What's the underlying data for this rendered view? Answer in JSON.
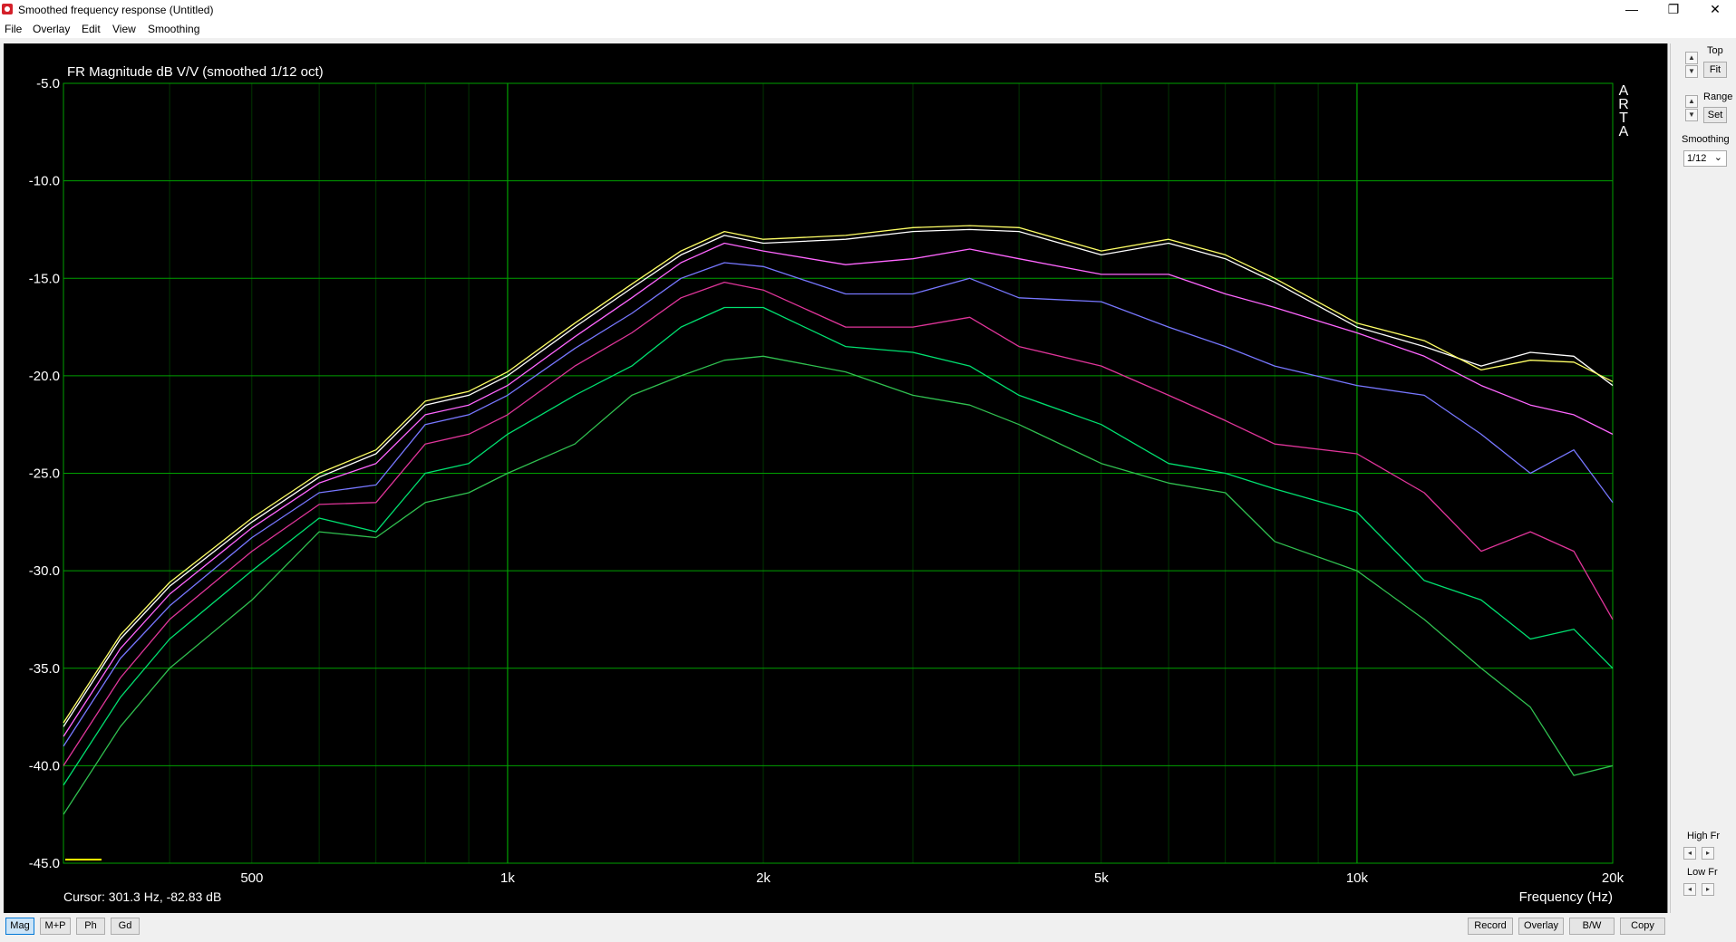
{
  "window": {
    "title": "Smoothed frequency response (Untitled)",
    "minimize_glyph": "—",
    "restore_glyph": "❐",
    "close_glyph": "✕"
  },
  "menu": [
    "File",
    "Overlay",
    "Edit",
    "View",
    "Smoothing"
  ],
  "plot": {
    "title": "FR Magnitude dB V/V (smoothed 1/12 oct)",
    "arta_letters": [
      "A",
      "R",
      "T",
      "A"
    ],
    "cursor_readout": "Cursor: 301.3 Hz, -82.83 dB",
    "background_color": "#000000",
    "grid_color": "#00a000"
  },
  "right_panel": {
    "top_label": "Top",
    "fit_label": "Fit",
    "range_label": "Range",
    "set_label": "Set",
    "smoothing_label": "Smoothing",
    "smoothing_value": "1/12",
    "high_fr_label": "High Fr",
    "low_fr_label": "Low Fr",
    "spin_up": "▲",
    "spin_down": "▼",
    "spin_left": "◂",
    "spin_right": "▸",
    "dropdown_glyph": "⌄"
  },
  "bottom_buttons_left": [
    "Mag",
    "M+P",
    "Ph",
    "Gd"
  ],
  "bottom_buttons_right": [
    "Record",
    "Overlay",
    "B/W",
    "Copy"
  ],
  "chart_data": {
    "type": "line",
    "title": "FR Magnitude dB V/V (smoothed 1/12 oct)",
    "xlabel": "Frequency (Hz)",
    "ylabel": "",
    "xscale": "log",
    "xlim": [
      300,
      20000
    ],
    "ylim": [
      -45,
      -5
    ],
    "x_ticks": [
      {
        "value": 500,
        "label": "500"
      },
      {
        "value": 1000,
        "label": "1k"
      },
      {
        "value": 2000,
        "label": "2k"
      },
      {
        "value": 5000,
        "label": "5k"
      },
      {
        "value": 10000,
        "label": "10k"
      },
      {
        "value": 20000,
        "label": "20k"
      }
    ],
    "y_ticks": [
      "-5.0",
      "-10.0",
      "-15.0",
      "-20.0",
      "-25.0",
      "-30.0",
      "-35.0",
      "-40.0",
      "-45.0"
    ],
    "grid": true,
    "x": [
      300,
      350,
      400,
      500,
      600,
      700,
      800,
      900,
      1000,
      1200,
      1400,
      1600,
      1800,
      2000,
      2500,
      3000,
      3500,
      4000,
      5000,
      6000,
      7000,
      8000,
      10000,
      12000,
      14000,
      16000,
      18000,
      20000
    ],
    "series": [
      {
        "color": "#ffffff",
        "values": [
          -38.0,
          -33.5,
          -30.8,
          -27.5,
          -25.2,
          -24.0,
          -21.5,
          -21.0,
          -20.0,
          -17.5,
          -15.5,
          -13.8,
          -12.8,
          -13.2,
          -13.0,
          -12.6,
          -12.5,
          -12.6,
          -13.8,
          -13.2,
          -14.0,
          -15.2,
          -17.5,
          -18.5,
          -19.5,
          -18.8,
          -19.0,
          -20.5
        ]
      },
      {
        "color": "#ffff66",
        "values": [
          -37.8,
          -33.3,
          -30.6,
          -27.3,
          -25.0,
          -23.8,
          -21.3,
          -20.8,
          -19.8,
          -17.3,
          -15.3,
          -13.6,
          -12.6,
          -13.0,
          -12.8,
          -12.4,
          -12.3,
          -12.4,
          -13.6,
          -13.0,
          -13.8,
          -15.0,
          -17.3,
          -18.2,
          -19.7,
          -19.2,
          -19.3,
          -20.3
        ]
      },
      {
        "color": "#ff66ff",
        "values": [
          -38.5,
          -34.0,
          -31.2,
          -27.8,
          -25.5,
          -24.5,
          -22.0,
          -21.5,
          -20.5,
          -18.0,
          -16.0,
          -14.2,
          -13.2,
          -13.6,
          -14.3,
          -14.0,
          -13.5,
          -14.0,
          -14.8,
          -14.8,
          -15.8,
          -16.5,
          -17.8,
          -19.0,
          -20.5,
          -21.5,
          -22.0,
          -23.0
        ]
      },
      {
        "color": "#7777ff",
        "values": [
          -39.0,
          -34.5,
          -31.8,
          -28.3,
          -26.0,
          -25.6,
          -22.5,
          -22.0,
          -21.0,
          -18.6,
          -16.8,
          -15.0,
          -14.2,
          -14.4,
          -15.8,
          -15.8,
          -15.0,
          -16.0,
          -16.2,
          -17.5,
          -18.5,
          -19.5,
          -20.5,
          -21.0,
          -23.0,
          -25.0,
          -23.8,
          -26.5
        ]
      },
      {
        "color": "#e0359a",
        "values": [
          -40.0,
          -35.5,
          -32.5,
          -29.0,
          -26.6,
          -26.5,
          -23.5,
          -23.0,
          -22.0,
          -19.5,
          -17.8,
          -16.0,
          -15.2,
          -15.6,
          -17.5,
          -17.5,
          -17.0,
          -18.5,
          -19.5,
          -21.0,
          -22.3,
          -23.5,
          -24.0,
          -26.0,
          -29.0,
          -28.0,
          -29.0,
          -32.5
        ]
      },
      {
        "color": "#00e070",
        "values": [
          -41.0,
          -36.5,
          -33.5,
          -30.0,
          -27.3,
          -28.0,
          -25.0,
          -24.5,
          -23.0,
          -21.0,
          -19.5,
          -17.5,
          -16.5,
          -16.5,
          -18.5,
          -18.8,
          -19.5,
          -21.0,
          -22.5,
          -24.5,
          -25.0,
          -25.8,
          -27.0,
          -30.5,
          -31.5,
          -33.5,
          -33.0,
          -35.0
        ]
      },
      {
        "color": "#30c050",
        "values": [
          -42.5,
          -38.0,
          -35.0,
          -31.5,
          -28.0,
          -28.3,
          -26.5,
          -26.0,
          -25.0,
          -23.5,
          -21.0,
          -20.0,
          -19.2,
          -19.0,
          -19.8,
          -21.0,
          -21.5,
          -22.5,
          -24.5,
          -25.5,
          -26.0,
          -28.5,
          -30.0,
          -32.5,
          -35.0,
          -37.0,
          -40.5,
          -40.0
        ]
      }
    ]
  }
}
